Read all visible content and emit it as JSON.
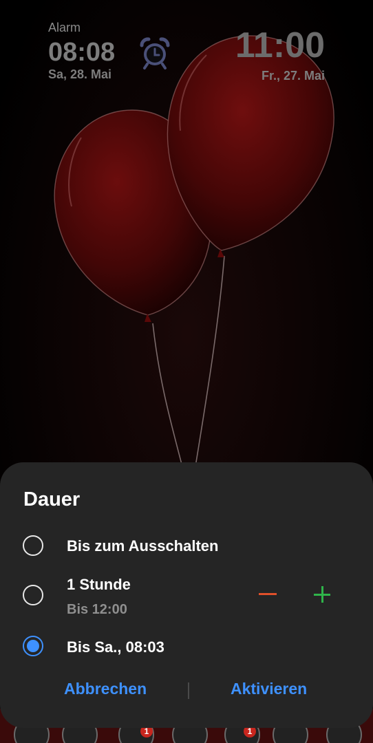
{
  "lockscreen": {
    "alarm_label": "Alarm",
    "alarm_time": "08:08",
    "alarm_date": "Sa, 28. Mai",
    "clock_time": "11:00",
    "clock_date": "Fr., 27. Mai",
    "alarm_icon": "alarm-clock-icon",
    "alarm_icon_color": "#4a5078"
  },
  "dialog": {
    "title": "Dauer",
    "options": [
      {
        "label": "Bis zum Ausschalten",
        "sub": "",
        "selected": false
      },
      {
        "label": "1 Stunde",
        "sub": "Bis 12:00",
        "selected": false
      },
      {
        "label": "Bis Sa., 08:03",
        "sub": "",
        "selected": true
      }
    ],
    "cancel_label": "Abbrechen",
    "confirm_label": "Aktivieren"
  },
  "dock": {
    "badges": [
      "1",
      "1"
    ]
  },
  "colors": {
    "accent": "#3e91ff",
    "sheet_bg": "#252525",
    "minus": "#e0502a",
    "plus": "#2fb44a"
  }
}
